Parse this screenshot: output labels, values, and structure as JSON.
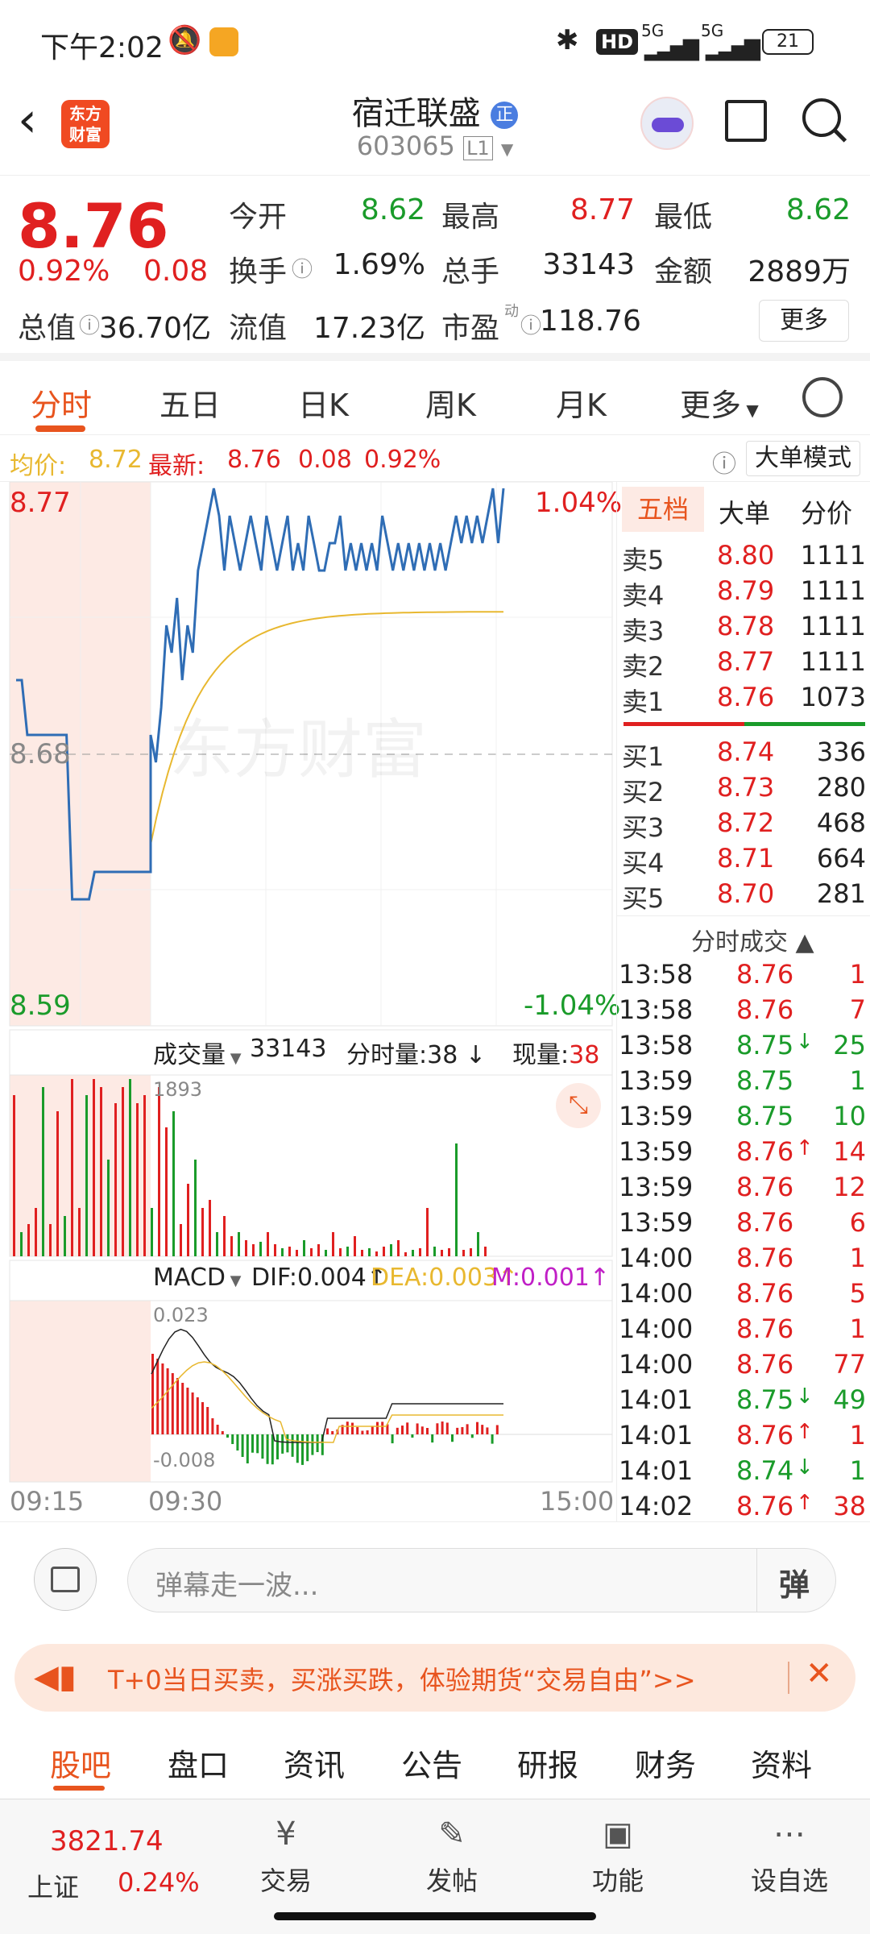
{
  "status": {
    "time": "下午2:02",
    "hd": "HD",
    "net1": "5G",
    "net2": "5G",
    "battery": "21"
  },
  "header": {
    "logo_line1": "东方",
    "logo_line2": "财富",
    "name": "宿迁联盛",
    "badge": "正",
    "code": "603065",
    "level": "L1"
  },
  "quote": {
    "price": "8.76",
    "change_pct": "0.92%",
    "change": "0.08",
    "labels": {
      "open": "今开",
      "high": "最高",
      "low": "最低",
      "turnover": "换手",
      "volume": "总手",
      "amount": "金额",
      "total_cap": "总值",
      "float_cap": "流值",
      "pe": "市盈",
      "pe_sup": "动"
    },
    "values": {
      "open": "8.62",
      "high": "8.77",
      "low": "8.62",
      "turnover": "1.69%",
      "volume": "33143",
      "amount": "2889万",
      "total_cap": "36.70亿",
      "float_cap": "17.23亿",
      "pe": "118.76"
    },
    "more": "更多"
  },
  "tabs": [
    "分时",
    "五日",
    "日K",
    "周K",
    "月K",
    "更多"
  ],
  "avg": {
    "label": "均价:",
    "value": "8.72",
    "latest_label": "最新:",
    "latest": "8.76",
    "chg": "0.08",
    "pct": "0.92%",
    "mode": "大单模式"
  },
  "chart": {
    "y_top": "8.77",
    "y_bottom": "8.59",
    "y_mid": "8.68",
    "pct_top": "1.04%",
    "pct_bottom": "-1.04%",
    "watermark": "东方财富",
    "vol_selector": "成交量",
    "vol_total": "33143",
    "vol_split_label": "分时量:",
    "vol_split": "38",
    "vol_now_label": "现量:",
    "vol_now": "38",
    "vol_max": "1893",
    "macd_selector": "MACD",
    "dif": "DIF:0.004",
    "dea": "DEA:0.003",
    "m": "M:0.001",
    "macd_max": "0.023",
    "macd_min": "-0.008",
    "time_start": "09:15",
    "time_open": "09:30",
    "time_end": "15:00"
  },
  "book": {
    "tabs": [
      "五档",
      "大单",
      "分价"
    ],
    "asks": [
      {
        "label": "卖5",
        "price": "8.80",
        "vol": "1111"
      },
      {
        "label": "卖4",
        "price": "8.79",
        "vol": "1111"
      },
      {
        "label": "卖3",
        "price": "8.78",
        "vol": "1111"
      },
      {
        "label": "卖2",
        "price": "8.77",
        "vol": "1111"
      },
      {
        "label": "卖1",
        "price": "8.76",
        "vol": "1073"
      }
    ],
    "bids": [
      {
        "label": "买1",
        "price": "8.74",
        "vol": "336"
      },
      {
        "label": "买2",
        "price": "8.73",
        "vol": "280"
      },
      {
        "label": "买3",
        "price": "8.72",
        "vol": "468"
      },
      {
        "label": "买4",
        "price": "8.71",
        "vol": "664"
      },
      {
        "label": "买5",
        "price": "8.70",
        "vol": "281"
      }
    ],
    "ticks_title": "分时成交",
    "ticks": [
      {
        "t": "13:58",
        "p": "8.76",
        "a": "",
        "v": "1",
        "c": "red"
      },
      {
        "t": "13:58",
        "p": "8.76",
        "a": "",
        "v": "7",
        "c": "red"
      },
      {
        "t": "13:58",
        "p": "8.75",
        "a": "↓",
        "v": "25",
        "c": "green"
      },
      {
        "t": "13:59",
        "p": "8.75",
        "a": "",
        "v": "1",
        "c": "green"
      },
      {
        "t": "13:59",
        "p": "8.75",
        "a": "",
        "v": "10",
        "c": "green"
      },
      {
        "t": "13:59",
        "p": "8.76",
        "a": "↑",
        "v": "14",
        "c": "red"
      },
      {
        "t": "13:59",
        "p": "8.76",
        "a": "",
        "v": "12",
        "c": "red"
      },
      {
        "t": "13:59",
        "p": "8.76",
        "a": "",
        "v": "6",
        "c": "red"
      },
      {
        "t": "14:00",
        "p": "8.76",
        "a": "",
        "v": "1",
        "c": "red"
      },
      {
        "t": "14:00",
        "p": "8.76",
        "a": "",
        "v": "5",
        "c": "red"
      },
      {
        "t": "14:00",
        "p": "8.76",
        "a": "",
        "v": "1",
        "c": "red"
      },
      {
        "t": "14:00",
        "p": "8.76",
        "a": "",
        "v": "77",
        "c": "red"
      },
      {
        "t": "14:01",
        "p": "8.75",
        "a": "↓",
        "v": "49",
        "c": "green"
      },
      {
        "t": "14:01",
        "p": "8.76",
        "a": "↑",
        "v": "1",
        "c": "red"
      },
      {
        "t": "14:01",
        "p": "8.74",
        "a": "↓",
        "v": "1",
        "c": "green"
      },
      {
        "t": "14:02",
        "p": "8.76",
        "a": "↑",
        "v": "38",
        "c": "red"
      }
    ]
  },
  "comment": {
    "placeholder": "弹幕走一波...",
    "danmu": "弹"
  },
  "ad": {
    "text": "T+0当日买卖，买涨买跌，体验期货“交易自由”>>"
  },
  "subtabs": [
    "股吧",
    "盘口",
    "资讯",
    "公告",
    "研报",
    "财务",
    "资料"
  ],
  "bottom": {
    "index_value": "3821.74",
    "index_name": "上证",
    "index_pct": "0.24%",
    "items": [
      "交易",
      "发帖",
      "功能",
      "设自选"
    ]
  },
  "colors": {
    "up": "#e02020",
    "down": "#1a9b2a",
    "accent": "#e8541e",
    "price_line": "#2f6db5",
    "avg_line": "#e8b830"
  }
}
